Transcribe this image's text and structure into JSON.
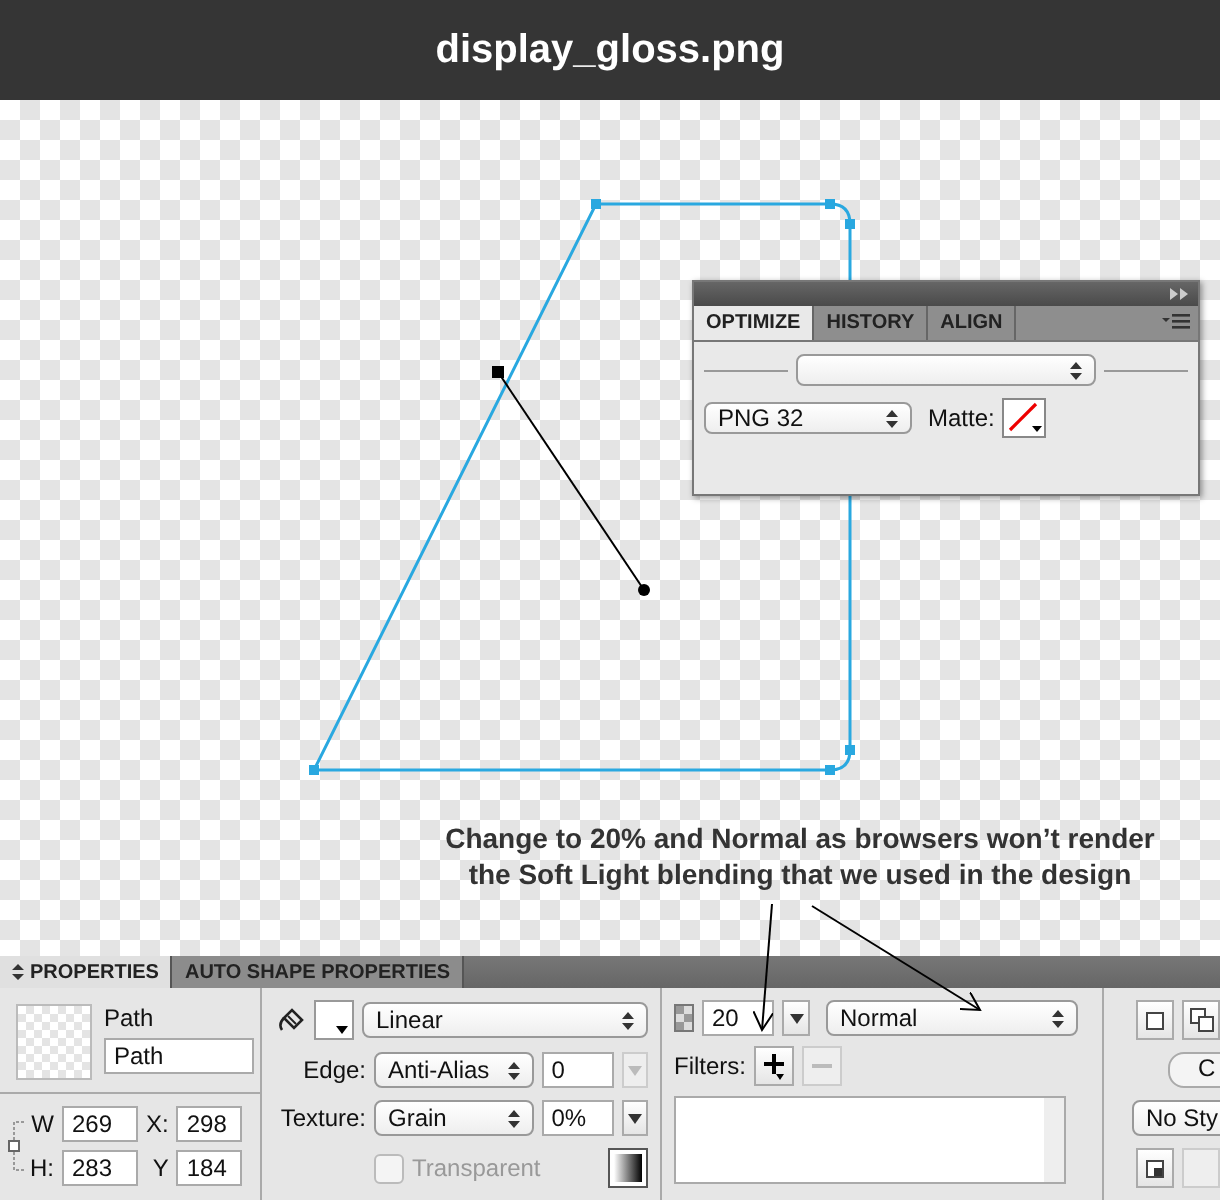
{
  "window": {
    "title": "display_gloss.png"
  },
  "annotation": "Change to 20% and Normal as browsers won’t render\nthe Soft Light blending that we used in the design",
  "optimize_panel": {
    "tabs": [
      {
        "label": "OPTIMIZE",
        "selected": true
      },
      {
        "label": "HISTORY",
        "selected": false
      },
      {
        "label": "ALIGN",
        "selected": false
      }
    ],
    "export_format": "PNG 32",
    "matte_label": "Matte:"
  },
  "properties_panel": {
    "tabs": [
      {
        "label": "PROPERTIES",
        "selected": true
      },
      {
        "label": "AUTO SHAPE PROPERTIES",
        "selected": false
      }
    ],
    "object_type": "Path",
    "name": "Path",
    "geometry": [
      {
        "label": "W",
        "value": "269"
      },
      {
        "label": "X:",
        "value": "298"
      },
      {
        "label": "H:",
        "value": "283"
      },
      {
        "label": "Y",
        "value": "184"
      }
    ],
    "fill_type": "Linear",
    "edge_label": "Edge:",
    "edge": "Anti-Alias",
    "feather": "0",
    "texture_label": "Texture:",
    "texture": "Grain",
    "texture_amount": "0%",
    "transparent": {
      "label": "Transparent",
      "checked": false,
      "disabled": true
    },
    "opacity": "20",
    "blend_mode": "Normal",
    "filters_label": "Filters:",
    "remove_filter_disabled": true,
    "style_button": "C",
    "style_select": "No Sty"
  }
}
